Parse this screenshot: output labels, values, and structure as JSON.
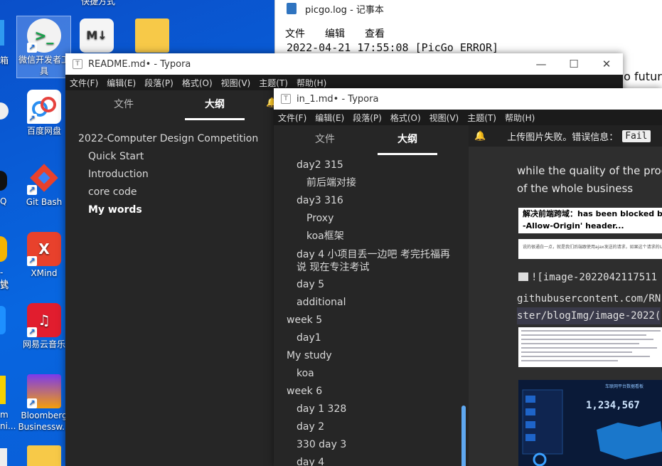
{
  "desktop": {
    "icons": [
      {
        "label": "快捷方式",
        "glyph": ""
      },
      {
        "label": "微信开发者工具",
        "glyph": ">_"
      },
      {
        "label": "",
        "glyph": "M↓"
      },
      {
        "label": "",
        "glyph": ""
      },
      {
        "label": "百度网盘",
        "glyph": ""
      },
      {
        "label": "Git Bash",
        "glyph": ""
      },
      {
        "label": "XMind",
        "glyph": "X"
      },
      {
        "label": "网易云音乐",
        "glyph": "♫"
      },
      {
        "label": "Bloomberg Businessw...",
        "glyph": ""
      }
    ],
    "left_strip": [
      "箱",
      "Q",
      "- 快",
      "式",
      "m",
      "ni..."
    ]
  },
  "notepad": {
    "title": "picgo.log - 记事本",
    "menu": [
      "文件",
      "编辑",
      "查看"
    ],
    "log_line": "2022-04-21 17:55:08 [PicGo ERROR]",
    "right_text": "do futur"
  },
  "typora_back": {
    "title": "README.md• - Typora",
    "menu": [
      "文件(F)",
      "编辑(E)",
      "段落(P)",
      "格式(O)",
      "视图(V)",
      "主题(T)",
      "帮助(H)"
    ],
    "tabs": [
      "文件",
      "大纲"
    ],
    "outline": [
      {
        "text": "2022-Computer Design Competition",
        "level": 1
      },
      {
        "text": "Quick Start",
        "level": 2
      },
      {
        "text": "Introduction",
        "level": 2
      },
      {
        "text": "core code",
        "level": 2
      },
      {
        "text": "My words",
        "level": 2,
        "bold": true
      }
    ]
  },
  "typora_front": {
    "title": "in_1.md• - Typora",
    "menu": [
      "文件(F)",
      "编辑(E)",
      "段落(P)",
      "格式(O)",
      "视图(V)",
      "主题(T)",
      "帮助(H)"
    ],
    "tabs": [
      "文件",
      "大纲"
    ],
    "outline": [
      {
        "text": "day2 315",
        "level": 2
      },
      {
        "text": "前后端对接",
        "level": 3
      },
      {
        "text": "day3 316",
        "level": 2
      },
      {
        "text": "Proxy",
        "level": 3
      },
      {
        "text": "koa框架",
        "level": 3
      },
      {
        "text": "day 4 小项目丢一边吧 考完托福再",
        "level": 2
      },
      {
        "text": "说 现在专注考试",
        "level": 2
      },
      {
        "text": "day 5",
        "level": 2
      },
      {
        "text": "additional",
        "level": 2
      },
      {
        "text": "week 5",
        "level": 1
      },
      {
        "text": "day1",
        "level": 2
      },
      {
        "text": "My study",
        "level": 1
      },
      {
        "text": "koa",
        "level": 2
      },
      {
        "text": "week 6",
        "level": 1
      },
      {
        "text": "day 1 328",
        "level": 2
      },
      {
        "text": "day 2",
        "level": 2
      },
      {
        "text": "330 day 3",
        "level": 2
      },
      {
        "text": "day 4",
        "level": 2
      }
    ],
    "notice": {
      "text": "上传图片失败。错误信息：",
      "code": "Fail"
    },
    "editor": {
      "para_line1": "while the quality of the proc",
      "para_line2": "of the whole business",
      "img1_caption_line1": "解决前端跨域：has been blocked by CO",
      "img1_caption_line2": "-Allow-Origin' header...",
      "img1_subtext": "说的很通白一点，就是我们后端跟使用ajax发送的请求，如果这个请求的URL",
      "code_line1": "![image-2022042117511",
      "code_line2": "githubusercontent.com/RN",
      "code_line3": "ster/blogImg/image-2022(",
      "dashboard_number": "1,234,567",
      "dashboard_title": "车联网平台数据看板"
    }
  },
  "colors": {
    "desktop_bg": "#0866e0",
    "typora_bg": "#262626",
    "accent_scroll": "#5fa8f0"
  }
}
